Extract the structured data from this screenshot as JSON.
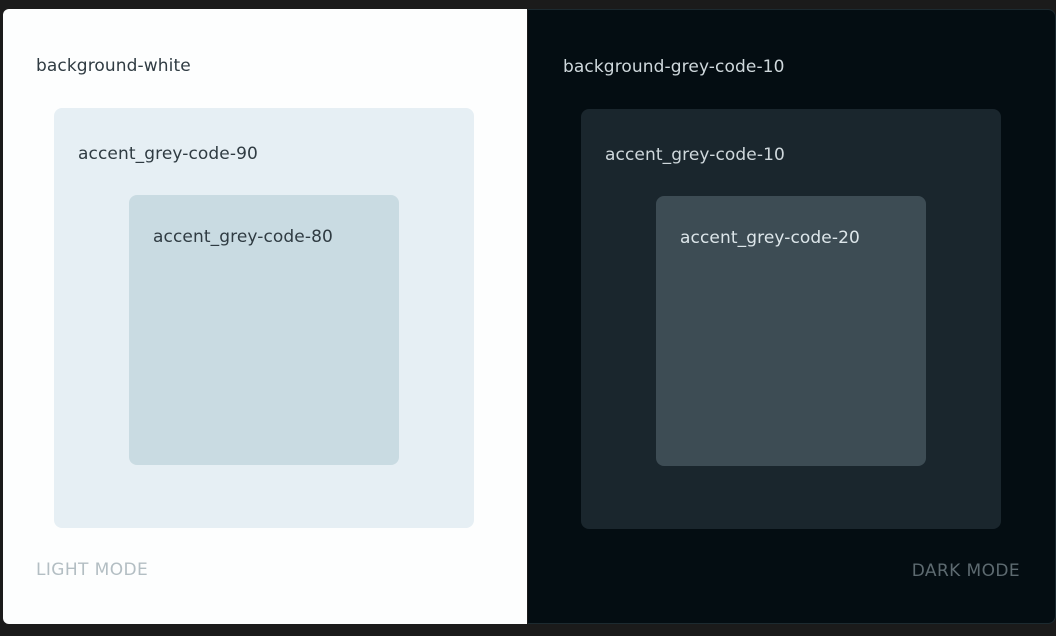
{
  "light": {
    "background_label": "background-white",
    "outer_label": "accent_grey-code-90",
    "inner_label": "accent_grey-code-80",
    "mode_label": "LIGHT MODE",
    "colors": {
      "background": "#fdfefe",
      "outer": "#e6eff4",
      "inner": "#c9dbe2"
    }
  },
  "dark": {
    "background_label": "background-grey-code-10",
    "outer_label": "accent_grey-code-10",
    "inner_label": "accent_grey-code-20",
    "mode_label": "DARK MODE",
    "colors": {
      "background": "#040d12",
      "outer": "#1a262d",
      "inner": "#3d4c54"
    }
  }
}
